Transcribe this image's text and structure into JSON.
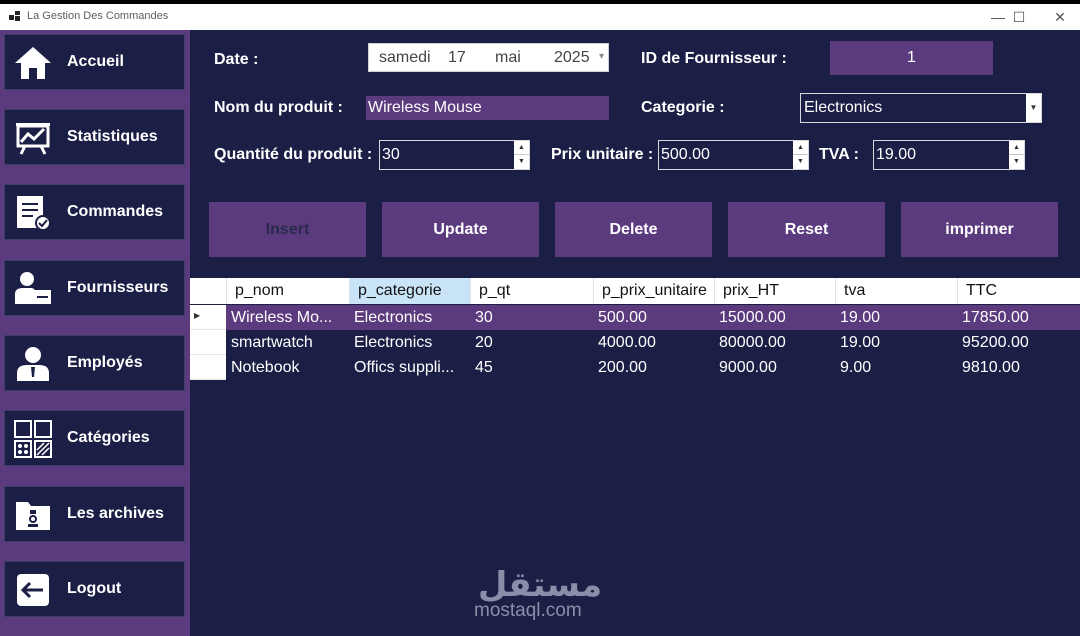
{
  "window": {
    "title": "La Gestion Des Commandes",
    "minimize": "—",
    "maximize": "☐",
    "close": "✕"
  },
  "sidebar": {
    "items": [
      {
        "label": "Accueil",
        "icon": "home-icon"
      },
      {
        "label": "Statistiques",
        "icon": "presentation-chart-icon"
      },
      {
        "label": "Commandes",
        "icon": "order-checklist-icon"
      },
      {
        "label": "Fournisseurs",
        "icon": "supplier-icon"
      },
      {
        "label": "Employés",
        "icon": "employee-icon"
      },
      {
        "label": "Catégories",
        "icon": "categories-grid-icon"
      },
      {
        "label": "Les archives",
        "icon": "archive-folder-icon"
      },
      {
        "label": "Logout",
        "icon": "logout-icon"
      }
    ]
  },
  "form": {
    "date_label": "Date :",
    "date": {
      "weekday": "samedi",
      "day": "17",
      "month": "mai",
      "year": "2025"
    },
    "supplier_id_label": "ID de Fournisseur :",
    "supplier_id": "1",
    "product_name_label": "Nom du produit :",
    "product_name": "Wireless Mouse",
    "category_label": "Categorie :",
    "category": "Electronics",
    "quantity_label": "Quantité du produit :",
    "quantity": "30",
    "unit_price_label": "Prix unitaire :",
    "unit_price": "500.00",
    "tva_label": "TVA :",
    "tva": "19.00"
  },
  "actions": {
    "insert": "Insert",
    "update": "Update",
    "delete": "Delete",
    "reset": "Reset",
    "print": "imprimer"
  },
  "table": {
    "columns": [
      "p_nom",
      "p_categorie",
      "p_qt",
      "p_prix_unitaire",
      "prix_HT",
      "tva",
      "TTC"
    ],
    "rows": [
      [
        "Wireless Mo...",
        "Electronics",
        "30",
        "500.00",
        "15000.00",
        "19.00",
        "17850.00"
      ],
      [
        "smartwatch",
        "Electronics",
        "20",
        "4000.00",
        "80000.00",
        "19.00",
        "95200.00"
      ],
      [
        "Notebook",
        "Offics suppli...",
        "45",
        "200.00",
        "9000.00",
        "9.00",
        "9810.00"
      ]
    ]
  },
  "watermark": {
    "arabic": "مستقل",
    "text": "mostaql.com"
  },
  "colors": {
    "sidebar_bg": "#5b3a7e",
    "panel_bg": "#1c1f45",
    "accent": "#5b3a7e",
    "header_selected": "#c9e3f7"
  }
}
